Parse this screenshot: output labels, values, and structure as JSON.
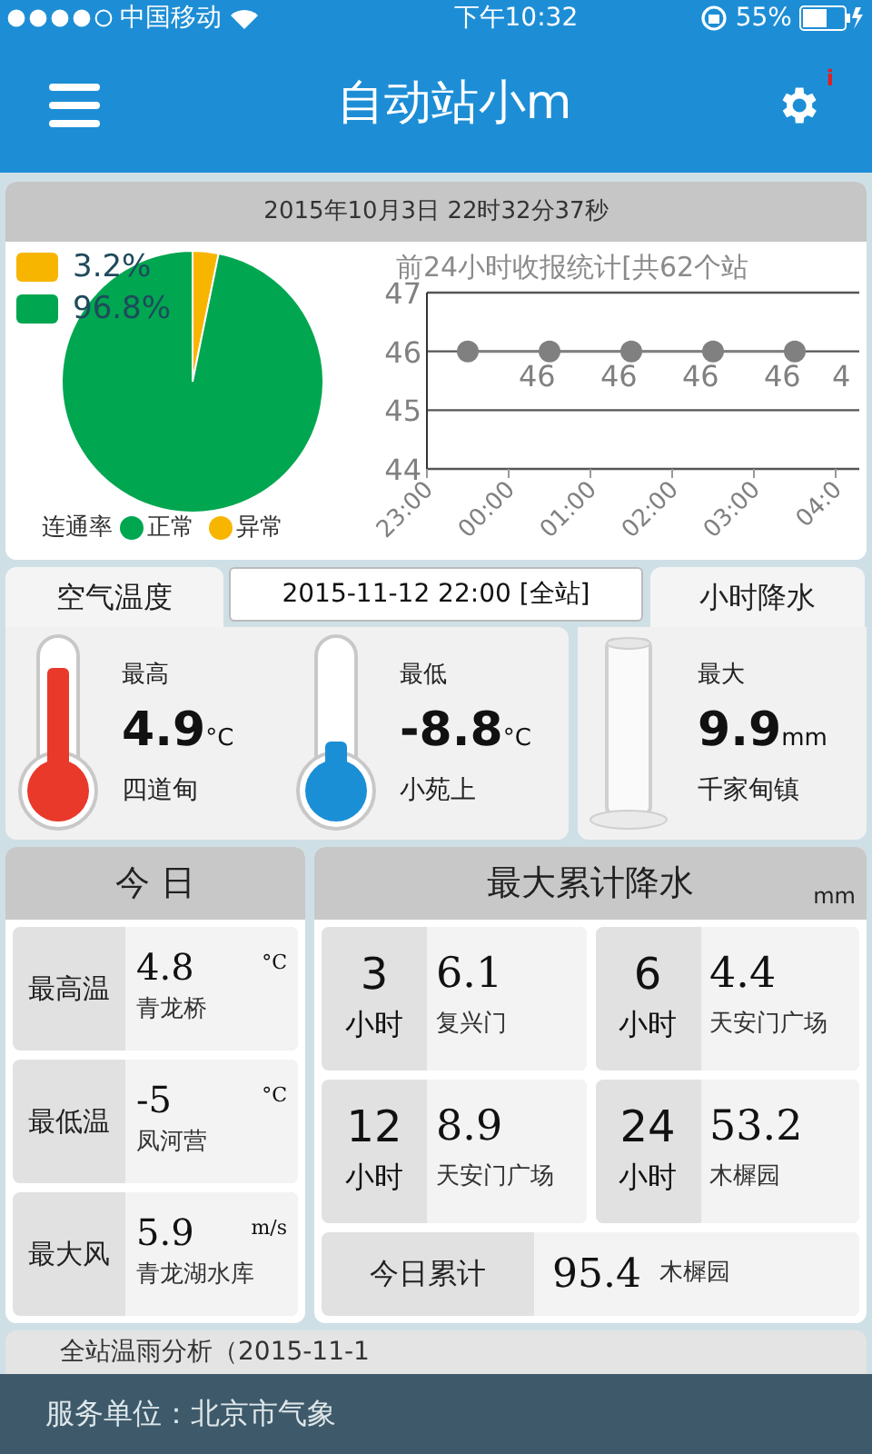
{
  "status_bar": {
    "carrier": "中国移动",
    "time": "下午10:32",
    "battery": "55%"
  },
  "header": {
    "title": "自动站小m",
    "settings_badge": "i"
  },
  "summary": {
    "timestamp": "2015年10月3日 22时32分37秒",
    "pie": {
      "legend": [
        {
          "label": "3.2%",
          "color": "#f7b500"
        },
        {
          "label": "96.8%",
          "color": "#00a650"
        }
      ],
      "caption": "连通率",
      "legend_bottom": [
        {
          "label": "正常",
          "color": "#00a650"
        },
        {
          "label": "异常",
          "color": "#f7b500"
        }
      ],
      "chart_data": {
        "type": "pie",
        "series": [
          {
            "values": [
              3.2,
              96.8
            ]
          }
        ]
      }
    },
    "line": {
      "chart_data": {
        "type": "line",
        "title": "前24小时收报统计[共62个站",
        "categories": [
          "23:00",
          null,
          "00:00",
          null,
          "01:00",
          null,
          "02:00",
          null,
          "03:00",
          null,
          "04:0",
          null
        ],
        "grid": true,
        "series": [
          {
            "color": "#808080",
            "marker": "circle",
            "values": [
              null,
              46,
              null,
              46,
              null,
              46,
              null,
              46,
              null,
              46,
              null,
              null
            ]
          }
        ],
        "ylim": [
          44,
          47
        ],
        "yticks": [
          44,
          45,
          46,
          47
        ],
        "value_labels": [
          null,
          null,
          null,
          "46",
          null,
          "46",
          null,
          "46",
          null,
          "46",
          null,
          "4"
        ]
      }
    }
  },
  "temperature": {
    "tab": "空气温度",
    "date": "2015-11-12 22:00 [全站]",
    "items": [
      {
        "label": "最高",
        "value": "4.9",
        "unit": "°C",
        "station": "四道甸",
        "color": "#e8392a",
        "level": 0.75
      },
      {
        "label": "最低",
        "value": "-8.8",
        "unit": "°C",
        "station": "小苑上",
        "color": "#1b8fd6",
        "level": 0.3
      }
    ]
  },
  "rain": {
    "tab": "小时降水",
    "label": "最大",
    "value": "9.9",
    "unit": "mm",
    "station": "千家甸镇"
  },
  "today": {
    "title": "今 日",
    "rows": [
      {
        "label": "最高温",
        "value": "4.8",
        "unit": "°C",
        "station": "青龙桥"
      },
      {
        "label": "最低温",
        "value": "-5",
        "unit": "°C",
        "station": "凤河营"
      },
      {
        "label": "最大风",
        "value": "5.9",
        "unit": "m/s",
        "station": "青龙湖水库"
      }
    ]
  },
  "precipitation": {
    "title": "最大累计降水",
    "unit": "mm",
    "cells": [
      {
        "hours": "3",
        "hours_unit": "小时",
        "value": "6.1",
        "station": "复兴门"
      },
      {
        "hours": "6",
        "hours_unit": "小时",
        "value": "4.4",
        "station": "天安门广场"
      },
      {
        "hours": "12",
        "hours_unit": "小时",
        "value": "8.9",
        "station": "天安门广场"
      },
      {
        "hours": "24",
        "hours_unit": "小时",
        "value": "53.2",
        "station": "木樨园"
      }
    ],
    "total": {
      "label": "今日累计",
      "value": "95.4",
      "station": "木樨园"
    }
  },
  "analysis": {
    "title": "全站温雨分析（2015-11-1"
  },
  "footer": {
    "text": "服务单位：北京市气象"
  }
}
